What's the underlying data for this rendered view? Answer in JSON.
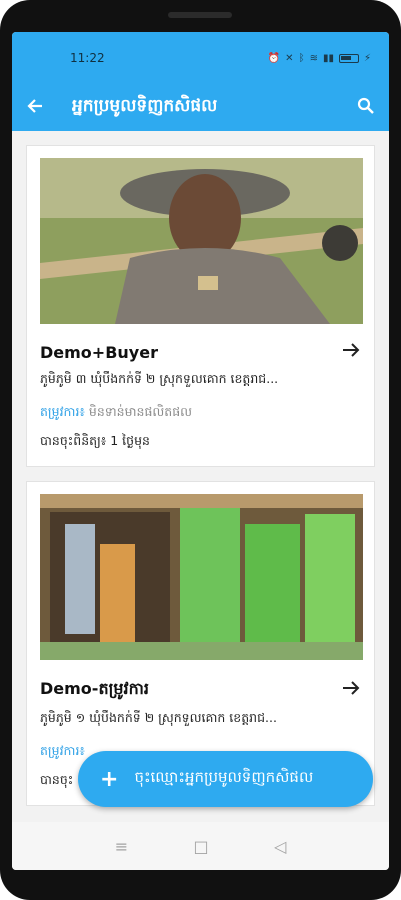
{
  "statusbar": {
    "time": "11:22",
    "icons": [
      "alarm-icon",
      "mute-icon",
      "bluetooth-icon",
      "wifi-icon",
      "signal-icon",
      "battery-icon",
      "charging-icon"
    ]
  },
  "appbar": {
    "title": "អ្នកប្រមូលទិញកសិផល",
    "back_icon": "arrow-left-icon",
    "search_icon": "search-icon"
  },
  "cards": [
    {
      "name": "Demo+Buyer",
      "address": "ភូមិភូមិ ៣ ឃុំបឹងកក់ទី ២ ស្រុកទួលគោក ខេត្តរាជ...",
      "needs_label": "តម្រូវការ៖",
      "needs_value": "មិនទាន់មានផលិតផល",
      "registered": "បានចុះពិនិត្យ៖ 1 ថ្ងៃមុន"
    },
    {
      "name": "Demo-តម្រូវការ",
      "address": "ភូមិភូមិ ១ ឃុំបឹងកក់ទី ២ ស្រុកទួលគោក ខេត្តរាជ...",
      "needs_label": "តម្រូវការ៖",
      "needs_value": "",
      "registered": "បានចុះ"
    }
  ],
  "fab": {
    "label": "ចុះឈ្មោះអ្នកប្រមូលទិញកសិផល",
    "icon": "plus-icon"
  },
  "navbar": {
    "menu_glyph": "≡",
    "home_glyph": "□",
    "back_glyph": "◁"
  },
  "colors": {
    "primary": "#2eaaf0",
    "needs_label": "#2ea0e6"
  }
}
